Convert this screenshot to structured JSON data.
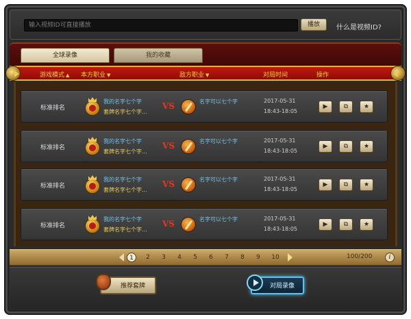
{
  "search": {
    "placeholder": "输入视频ID可直接播放",
    "play_label": "播放",
    "help_label": "什么是视频ID?"
  },
  "tabs": [
    {
      "label": "全球录像",
      "active": true
    },
    {
      "label": "我的收藏",
      "active": false
    }
  ],
  "columns": {
    "mode": "游戏模式",
    "my_class": "本方职业",
    "enemy_class": "敌方职业",
    "match_time": "对局时间",
    "actions": "操作"
  },
  "rows": [
    {
      "mode": "标准排名",
      "player1": "我的名字七个字",
      "deck": "套牌名字七个字...",
      "player2": "名字可以七个字",
      "date": "2017-05-31",
      "time": "18:43-18:05",
      "actions": [
        "play-icon",
        "share-icon",
        "star-icon"
      ]
    },
    {
      "mode": "标准排名",
      "player1": "我的名字七个字",
      "deck": "套牌名字七个字...",
      "player2": "名字可以七个字",
      "date": "2017-05-31",
      "time": "18:43-18:05",
      "actions": [
        "play-icon",
        "share-icon",
        "star-icon"
      ]
    },
    {
      "mode": "标准排名",
      "player1": "我的名字七个字",
      "deck": "套牌名字七个字...",
      "player2": "名字可以七个字",
      "date": "2017-05-31",
      "time": "18:43-18:05",
      "actions": [
        "play-icon",
        "share-icon",
        "star-icon"
      ]
    },
    {
      "mode": "标准排名",
      "player1": "我的名字七个字",
      "deck": "套牌名字七个字...",
      "player2": "名字可以七个字",
      "date": "2017-05-31",
      "time": "18:43-18:05",
      "actions": [
        "play-icon",
        "share-icon",
        "star-icon"
      ]
    }
  ],
  "vs_label": "VS",
  "pagination": {
    "pages": [
      "1",
      "2",
      "3",
      "4",
      "5",
      "6",
      "7",
      "8",
      "9",
      "10"
    ],
    "current": "1",
    "count": "100/200",
    "info": "i"
  },
  "bottom": {
    "deck_label": "推荐套牌",
    "replay_label": "对局录像"
  },
  "colors": {
    "accent_gold": "#f2c94c",
    "name_blue": "#6fc3e8",
    "vs_red": "#e03a20",
    "replay_glow": "#58c3ee"
  }
}
